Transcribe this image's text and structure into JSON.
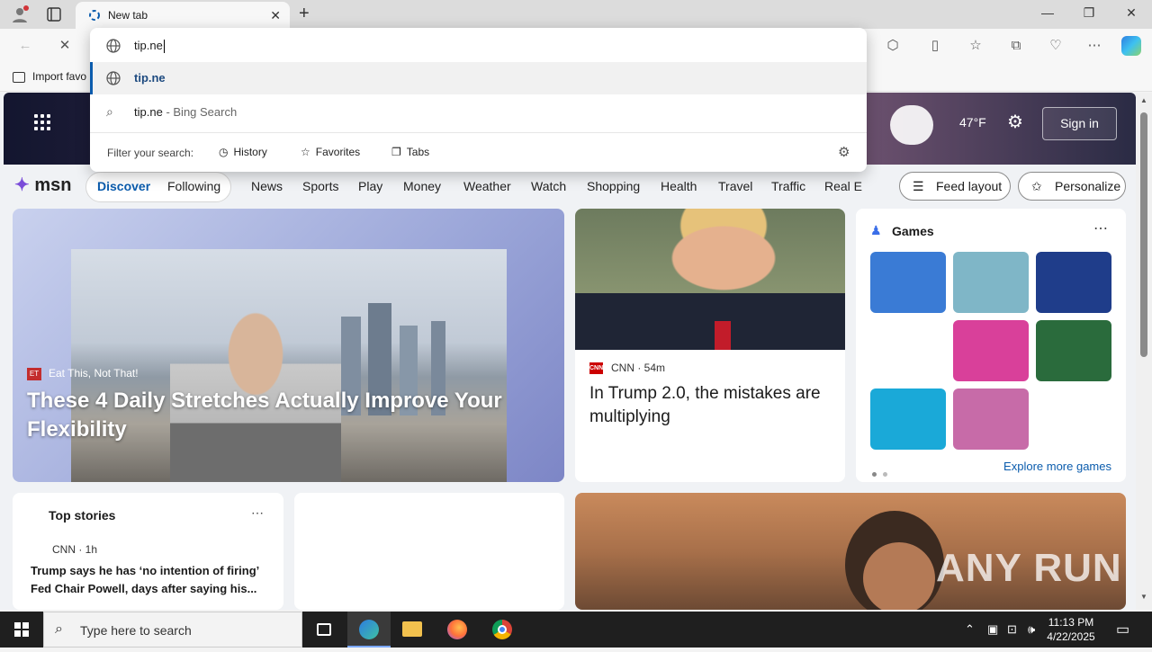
{
  "browser": {
    "tab_title": "New tab",
    "favorites_bar_item": "Import favo"
  },
  "omnibox": {
    "typed_value": "tip.ne",
    "suggestion_url": "tip.ne",
    "suggestion_search_term": "tip.ne",
    "suggestion_search_suffix": "- Bing Search",
    "filter_label": "Filter your search:",
    "filters": [
      "History",
      "Favorites",
      "Tabs"
    ]
  },
  "msn": {
    "logo": "msn",
    "weather": "47°F",
    "sign_in": "Sign in",
    "nav": [
      "Discover",
      "Following",
      "News",
      "Sports",
      "Play",
      "Money",
      "Weather",
      "Watch",
      "Shopping",
      "Health",
      "Travel",
      "Traffic",
      "Real E"
    ],
    "feed_layout": "Feed layout",
    "personalize": "Personalize"
  },
  "featured": {
    "source": "Eat This, Not That!",
    "title": "These 4 Daily Stretches Actually Improve Your Flexibility"
  },
  "trump_card": {
    "source": "CNN · 54m",
    "title": "In Trump 2.0, the mistakes are multiplying"
  },
  "games": {
    "title": "Games",
    "explore": "Explore more games",
    "tile_colors": [
      "#3a7bd5",
      "#7fb6c7",
      "#1f3d8a",
      "#d9409a",
      "#2a6b3c",
      "#1aa9d8",
      "#c76ba8"
    ]
  },
  "top_stories": {
    "title": "Top stories",
    "source": "CNN · 1h",
    "headline": "Trump says he has ‘no intention of firing’ Fed Chair Powell, days after saying his..."
  },
  "watermark": "ANY RUN",
  "taskbar": {
    "search_placeholder": "Type here to search",
    "time": "11:13 PM",
    "date": "4/22/2025"
  }
}
